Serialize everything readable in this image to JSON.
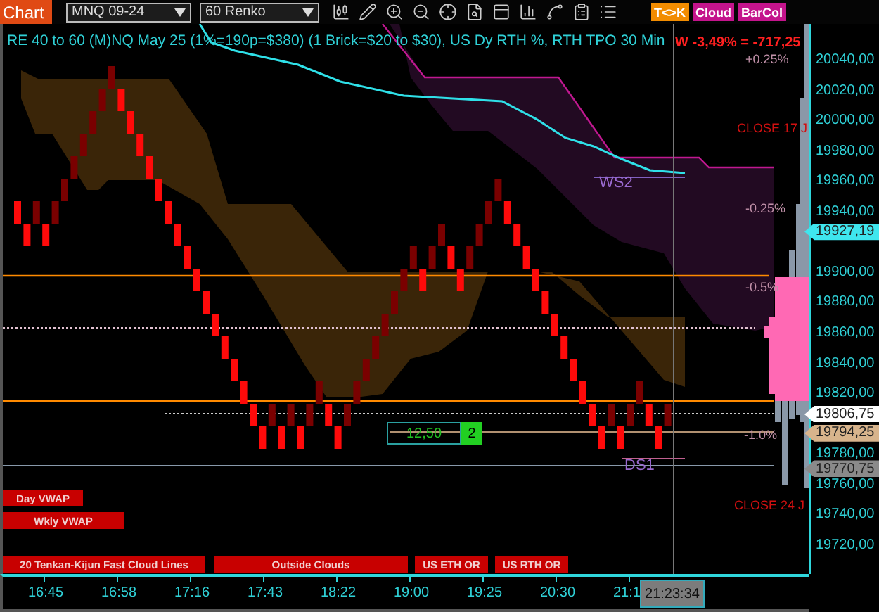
{
  "toolbar": {
    "tab": "Chart",
    "instrument": "MNQ 09-24",
    "bar_type": "60 Renko",
    "toggles": [
      {
        "label": "T<>K",
        "color": "#f28c00"
      },
      {
        "label": "Cloud",
        "color": "#c4148c"
      },
      {
        "label": "BarCol",
        "color": "#c4148c"
      }
    ]
  },
  "chart": {
    "title": "RE 40 to 60 (M)NQ May 25 (1%=190p=$380) (1 Brick=$20 to $30), US Dy RTH %, RTH TPO 30 Min",
    "weekly_change": "W -3,49% = -717,25",
    "level_labels": [
      {
        "text": "+0.25%",
        "kind": "percent"
      },
      {
        "text": "CLOSE 17 J",
        "kind": "close"
      },
      {
        "text": "WS2",
        "kind": "pivot"
      },
      {
        "text": "-0.25%",
        "kind": "percent"
      },
      {
        "text": "-0.5%",
        "kind": "percent"
      },
      {
        "text": "-1.0%",
        "kind": "percent"
      },
      {
        "text": "DS1",
        "kind": "pivot"
      },
      {
        "text": "CLOSE 24 J",
        "kind": "close"
      }
    ],
    "order_box": {
      "price": "12,50",
      "quantity": "2"
    },
    "indicator_buttons": [
      "Day VWAP",
      "Wkly VWAP",
      "20 Tenkan-Kijun Fast Cloud Lines",
      "Outside Clouds",
      "US ETH OR",
      "US RTH OR"
    ]
  },
  "price_axis": {
    "ticks": [
      "20040,00",
      "20020,00",
      "20000,00",
      "19980,00",
      "19960,00",
      "19940,00",
      "19900,00",
      "19880,00",
      "19860,00",
      "19840,00",
      "19820,00",
      "19780,00",
      "19760,00",
      "19740,00",
      "19720,00"
    ],
    "markers": [
      {
        "text": "19927,19",
        "color": "#3fe6ee"
      },
      {
        "text": "19806,75",
        "color": "#ffffff"
      },
      {
        "text": "19794,25",
        "color": "#d8b48c"
      },
      {
        "text": "19770,75",
        "color": "#8a8a8a"
      }
    ]
  },
  "time_axis": {
    "ticks": [
      "16:45",
      "16:58",
      "17:16",
      "17:43",
      "18:22",
      "19:00",
      "19:25",
      "20:30",
      "21:1"
    ],
    "cursor_time": "21:23:34"
  }
}
